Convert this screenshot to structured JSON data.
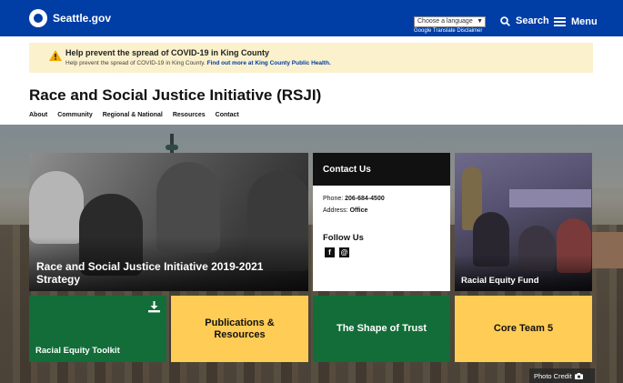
{
  "header": {
    "brand": "Seattle.gov",
    "language_select": "Choose a language",
    "translate_disclaimer": "Google Translate Disclaimer",
    "search_label": "Search",
    "menu_label": "Menu",
    "brand_color": "#003da5"
  },
  "alert": {
    "title": "Help prevent the spread of COVID-19 in King County",
    "body": "Help prevent the spread of COVID-19 in King County.",
    "link": "Find out more at King County Public Health."
  },
  "page": {
    "title": "Race and Social Justice Initiative (RSJI)",
    "nav": [
      "About",
      "Community",
      "Regional & National",
      "Resources",
      "Contact"
    ]
  },
  "tiles": {
    "strategy_caption": "Race and Social Justice Initiative 2019-2021 Strategy",
    "contact": {
      "heading": "Contact Us",
      "phone_label": "Phone:",
      "phone_value": "206-684-4500",
      "address_label": "Address:",
      "address_value": "Office",
      "follow_heading": "Follow Us",
      "social": [
        {
          "icon": "facebook-icon",
          "glyph": "f"
        },
        {
          "icon": "email-icon",
          "glyph": "@"
        }
      ]
    },
    "fund_caption": "Racial Equity Fund",
    "toolkit_label": "Racial Equity Toolkit",
    "publications_label": "Publications & Resources",
    "trust_label": "The Shape of Trust",
    "coreteam_label": "Core Team 5",
    "green_color": "#136d39",
    "yellow_color": "#ffcc55"
  },
  "photo_credit": "Photo Credit"
}
